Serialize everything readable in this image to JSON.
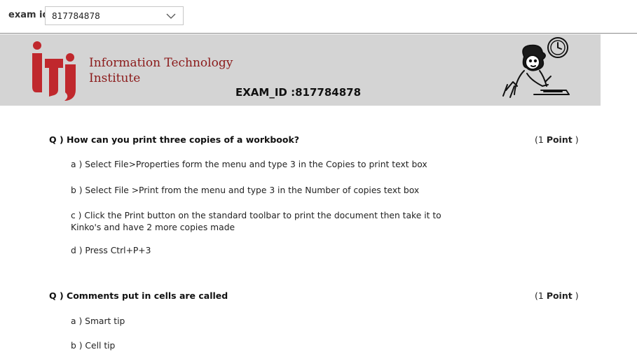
{
  "filter": {
    "label": "exam id",
    "value": "817784878"
  },
  "banner": {
    "institute_line1": "Information Technology",
    "institute_line2": "Institute",
    "exam_id_text": "EXAM_ID :817784878"
  },
  "questions": [
    {
      "text": "Q ) How can you print three copies of a workbook?",
      "points_prefix": "(1 ",
      "points_word": "Point",
      "points_suffix": " )",
      "answers": [
        "a ) Select File>Properties form the menu and type 3 in the Copies to print text box",
        "b ) Select File >Print from the menu and type 3 in the Number of copies text box",
        "c ) Click the Print button on the standard toolbar to print the document then take it to Kinko's and have 2 more copies made",
        "d ) Press Ctrl+P+3"
      ]
    },
    {
      "text": "Q ) Comments put in cells are called",
      "points_prefix": "(1 ",
      "points_word": "Point",
      "points_suffix": " )",
      "answers": [
        "a ) Smart tip",
        "b ) Cell tip"
      ]
    }
  ],
  "colors": {
    "brand_red": "#c0282d",
    "institute_text": "#8b1a1a",
    "banner_bg": "#d4d4d4"
  },
  "icons": {
    "dropdown": "chevron-down-icon",
    "logo": "iti-logo",
    "illustration": "student-writing-clock-illustration"
  }
}
